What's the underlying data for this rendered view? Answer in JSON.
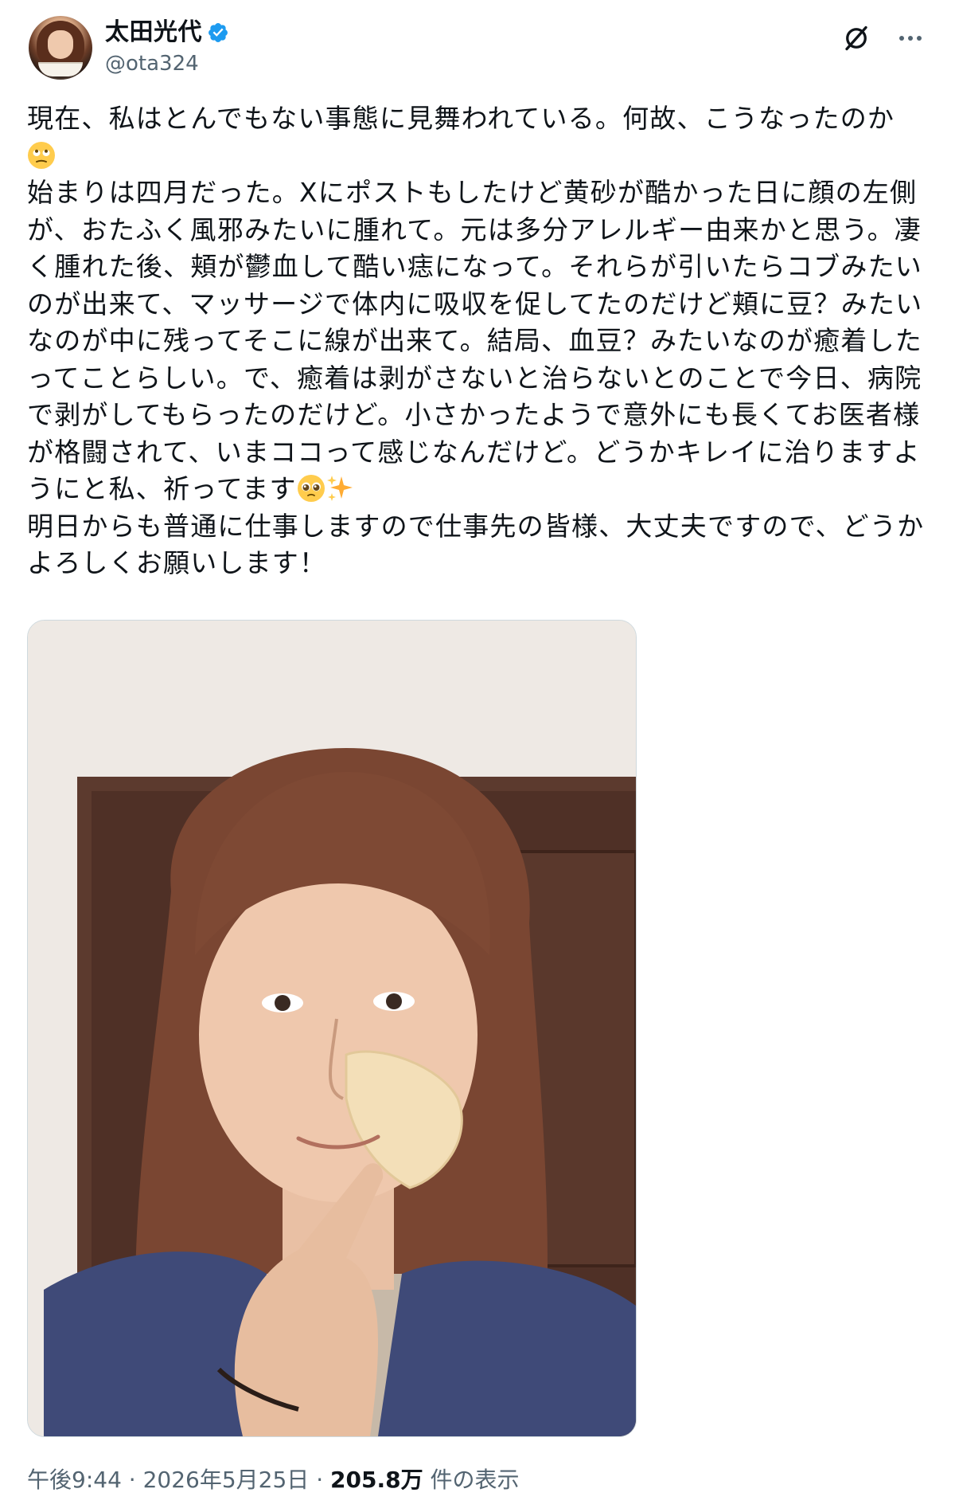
{
  "author": {
    "display_name": "太田光代",
    "handle": "@ota324",
    "verified": true
  },
  "icons": {
    "verified": "verified-badge-icon",
    "grok": "grok-icon",
    "more": "more-options-icon",
    "emoji_rolling_eyes": "face-with-rolling-eyes-emoji",
    "emoji_pleading": "pleading-face-emoji",
    "emoji_sparkles": "sparkles-emoji"
  },
  "colors": {
    "verified_blue": "#1d9bf0",
    "text_primary": "#0f1419",
    "text_secondary": "#536471",
    "border": "#cfd9de"
  },
  "tweet": {
    "line1": "現在、私はとんでもない事態に見舞われている。何故、こうなったのか",
    "paragraph2": "始まりは四月だった。Xにポストもしたけど黄砂が酷かった日に顔の左側が、おたふく風邪みたいに腫れて。元は多分アレルギー由来かと思う。凄く腫れた後、頬が鬱血して酷い痣になって。それらが引いたらコブみたいのが出来て、マッサージで体内に吸収を促してたのだけど頬に豆？みたいなのが中に残ってそこに線が出来て。結局、血豆？みたいなのが癒着したってことらしい。で、癒着は剥がさないと治らないとのことで今日、病院で剥がしてもらったのだけど。小さかったようで意外にも長くてお医者様が格闘されて、いまココって感じなんだけど。どうかキレイに治りますようにと私、祈ってます",
    "paragraph3": "明日からも普通に仕事しますので仕事先の皆様、大丈夫ですので、どうかよろしくお願いします！"
  },
  "meta": {
    "time": "午後9:44",
    "separator1": " · ",
    "date": "2026年5月25日",
    "separator2": " · ",
    "views_count": "205.8万",
    "views_label": " 件の表示"
  }
}
